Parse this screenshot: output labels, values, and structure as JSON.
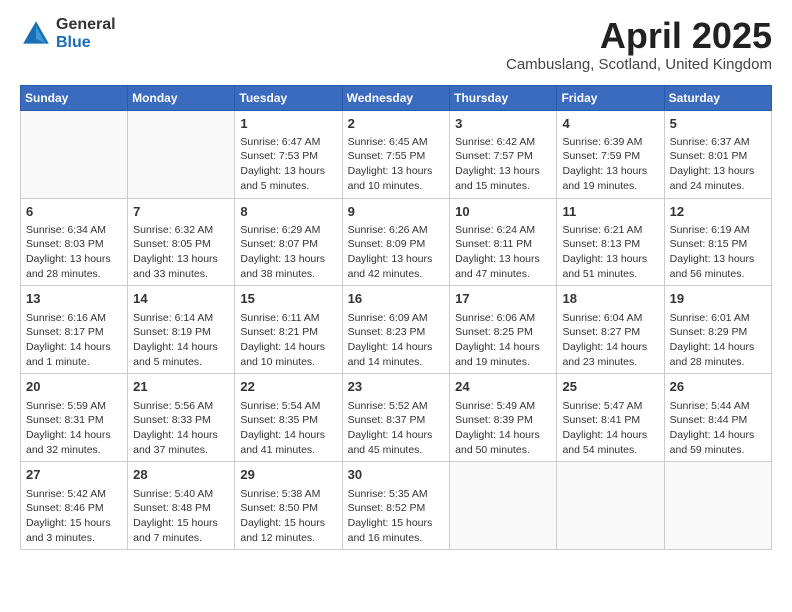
{
  "logo": {
    "general": "General",
    "blue": "Blue"
  },
  "title": {
    "month": "April 2025",
    "location": "Cambuslang, Scotland, United Kingdom"
  },
  "weekdays": [
    "Sunday",
    "Monday",
    "Tuesday",
    "Wednesday",
    "Thursday",
    "Friday",
    "Saturday"
  ],
  "weeks": [
    [
      {
        "day": "",
        "info": ""
      },
      {
        "day": "",
        "info": ""
      },
      {
        "day": "1",
        "info": "Sunrise: 6:47 AM\nSunset: 7:53 PM\nDaylight: 13 hours and 5 minutes."
      },
      {
        "day": "2",
        "info": "Sunrise: 6:45 AM\nSunset: 7:55 PM\nDaylight: 13 hours and 10 minutes."
      },
      {
        "day": "3",
        "info": "Sunrise: 6:42 AM\nSunset: 7:57 PM\nDaylight: 13 hours and 15 minutes."
      },
      {
        "day": "4",
        "info": "Sunrise: 6:39 AM\nSunset: 7:59 PM\nDaylight: 13 hours and 19 minutes."
      },
      {
        "day": "5",
        "info": "Sunrise: 6:37 AM\nSunset: 8:01 PM\nDaylight: 13 hours and 24 minutes."
      }
    ],
    [
      {
        "day": "6",
        "info": "Sunrise: 6:34 AM\nSunset: 8:03 PM\nDaylight: 13 hours and 28 minutes."
      },
      {
        "day": "7",
        "info": "Sunrise: 6:32 AM\nSunset: 8:05 PM\nDaylight: 13 hours and 33 minutes."
      },
      {
        "day": "8",
        "info": "Sunrise: 6:29 AM\nSunset: 8:07 PM\nDaylight: 13 hours and 38 minutes."
      },
      {
        "day": "9",
        "info": "Sunrise: 6:26 AM\nSunset: 8:09 PM\nDaylight: 13 hours and 42 minutes."
      },
      {
        "day": "10",
        "info": "Sunrise: 6:24 AM\nSunset: 8:11 PM\nDaylight: 13 hours and 47 minutes."
      },
      {
        "day": "11",
        "info": "Sunrise: 6:21 AM\nSunset: 8:13 PM\nDaylight: 13 hours and 51 minutes."
      },
      {
        "day": "12",
        "info": "Sunrise: 6:19 AM\nSunset: 8:15 PM\nDaylight: 13 hours and 56 minutes."
      }
    ],
    [
      {
        "day": "13",
        "info": "Sunrise: 6:16 AM\nSunset: 8:17 PM\nDaylight: 14 hours and 1 minute."
      },
      {
        "day": "14",
        "info": "Sunrise: 6:14 AM\nSunset: 8:19 PM\nDaylight: 14 hours and 5 minutes."
      },
      {
        "day": "15",
        "info": "Sunrise: 6:11 AM\nSunset: 8:21 PM\nDaylight: 14 hours and 10 minutes."
      },
      {
        "day": "16",
        "info": "Sunrise: 6:09 AM\nSunset: 8:23 PM\nDaylight: 14 hours and 14 minutes."
      },
      {
        "day": "17",
        "info": "Sunrise: 6:06 AM\nSunset: 8:25 PM\nDaylight: 14 hours and 19 minutes."
      },
      {
        "day": "18",
        "info": "Sunrise: 6:04 AM\nSunset: 8:27 PM\nDaylight: 14 hours and 23 minutes."
      },
      {
        "day": "19",
        "info": "Sunrise: 6:01 AM\nSunset: 8:29 PM\nDaylight: 14 hours and 28 minutes."
      }
    ],
    [
      {
        "day": "20",
        "info": "Sunrise: 5:59 AM\nSunset: 8:31 PM\nDaylight: 14 hours and 32 minutes."
      },
      {
        "day": "21",
        "info": "Sunrise: 5:56 AM\nSunset: 8:33 PM\nDaylight: 14 hours and 37 minutes."
      },
      {
        "day": "22",
        "info": "Sunrise: 5:54 AM\nSunset: 8:35 PM\nDaylight: 14 hours and 41 minutes."
      },
      {
        "day": "23",
        "info": "Sunrise: 5:52 AM\nSunset: 8:37 PM\nDaylight: 14 hours and 45 minutes."
      },
      {
        "day": "24",
        "info": "Sunrise: 5:49 AM\nSunset: 8:39 PM\nDaylight: 14 hours and 50 minutes."
      },
      {
        "day": "25",
        "info": "Sunrise: 5:47 AM\nSunset: 8:41 PM\nDaylight: 14 hours and 54 minutes."
      },
      {
        "day": "26",
        "info": "Sunrise: 5:44 AM\nSunset: 8:44 PM\nDaylight: 14 hours and 59 minutes."
      }
    ],
    [
      {
        "day": "27",
        "info": "Sunrise: 5:42 AM\nSunset: 8:46 PM\nDaylight: 15 hours and 3 minutes."
      },
      {
        "day": "28",
        "info": "Sunrise: 5:40 AM\nSunset: 8:48 PM\nDaylight: 15 hours and 7 minutes."
      },
      {
        "day": "29",
        "info": "Sunrise: 5:38 AM\nSunset: 8:50 PM\nDaylight: 15 hours and 12 minutes."
      },
      {
        "day": "30",
        "info": "Sunrise: 5:35 AM\nSunset: 8:52 PM\nDaylight: 15 hours and 16 minutes."
      },
      {
        "day": "",
        "info": ""
      },
      {
        "day": "",
        "info": ""
      },
      {
        "day": "",
        "info": ""
      }
    ]
  ]
}
